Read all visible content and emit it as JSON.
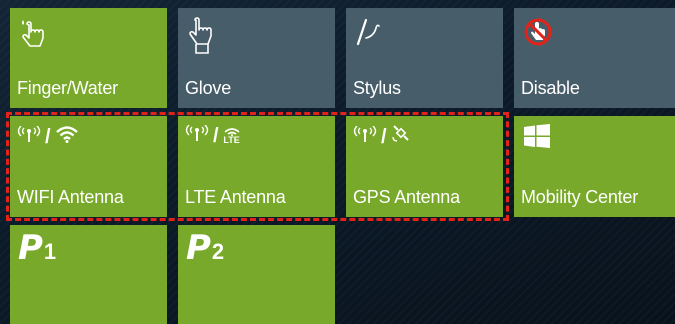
{
  "tiles": {
    "finger_water": {
      "label": "Finger/Water"
    },
    "glove": {
      "label": "Glove"
    },
    "stylus": {
      "label": "Stylus"
    },
    "disable": {
      "label": "Disable"
    },
    "wifi": {
      "label": "WIFI Antenna",
      "separator": "/"
    },
    "lte": {
      "label": "LTE Antenna",
      "separator": "/",
      "badge": "LTE"
    },
    "gps": {
      "label": "GPS Antenna",
      "separator": "/"
    },
    "mobility": {
      "label": "Mobility Center"
    },
    "p1": {
      "number": "1"
    },
    "p2": {
      "number": "2"
    }
  },
  "colors": {
    "tile_green": "#78a92a",
    "tile_slate": "#485d6a",
    "highlight_dash": "#e2231a",
    "background": "#0b1622"
  },
  "icons": {
    "finger_water": "touch-finger-water-icon",
    "glove": "touch-glove-icon",
    "stylus": "stylus-icon",
    "disable": "touch-disabled-icon",
    "antenna": "antenna-icon",
    "wifi": "wifi-icon",
    "lte": "lte-icon",
    "gps": "gps-satellite-icon",
    "windows": "windows-logo-icon",
    "programmable": "programmable-key-icon"
  }
}
